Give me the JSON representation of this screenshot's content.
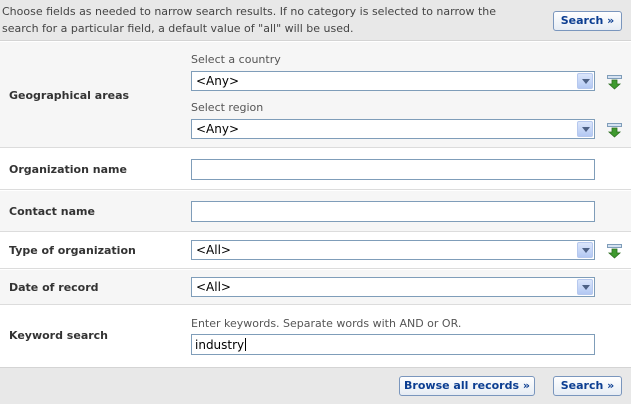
{
  "intro": {
    "line1": "Choose fields as needed to narrow search results. If no category is selected to narrow the",
    "line2": "search for a particular field, a default value of \"all\" will be used."
  },
  "buttons": {
    "search_top": "Search »",
    "browse_all": "Browse all records »",
    "search_bottom": "Search »"
  },
  "fields": {
    "geo": {
      "label": "Geographical areas",
      "country_hint": "Select a country",
      "country_value": "<Any>",
      "region_hint": "Select region",
      "region_value": "<Any>"
    },
    "org_name": {
      "label": "Organization name",
      "value": ""
    },
    "contact_name": {
      "label": "Contact name",
      "value": ""
    },
    "org_type": {
      "label": "Type of organization",
      "value": "<All>"
    },
    "date": {
      "label": "Date of record",
      "value": "<All>"
    },
    "keyword": {
      "label": "Keyword search",
      "hint": "Enter keywords. Separate words with AND or OR.",
      "value": "industry"
    }
  },
  "icons": {
    "add_multi": "add-multiple-icon"
  },
  "colors": {
    "button_text": "#0b3d91",
    "icon_green": "#3f9a2f"
  }
}
